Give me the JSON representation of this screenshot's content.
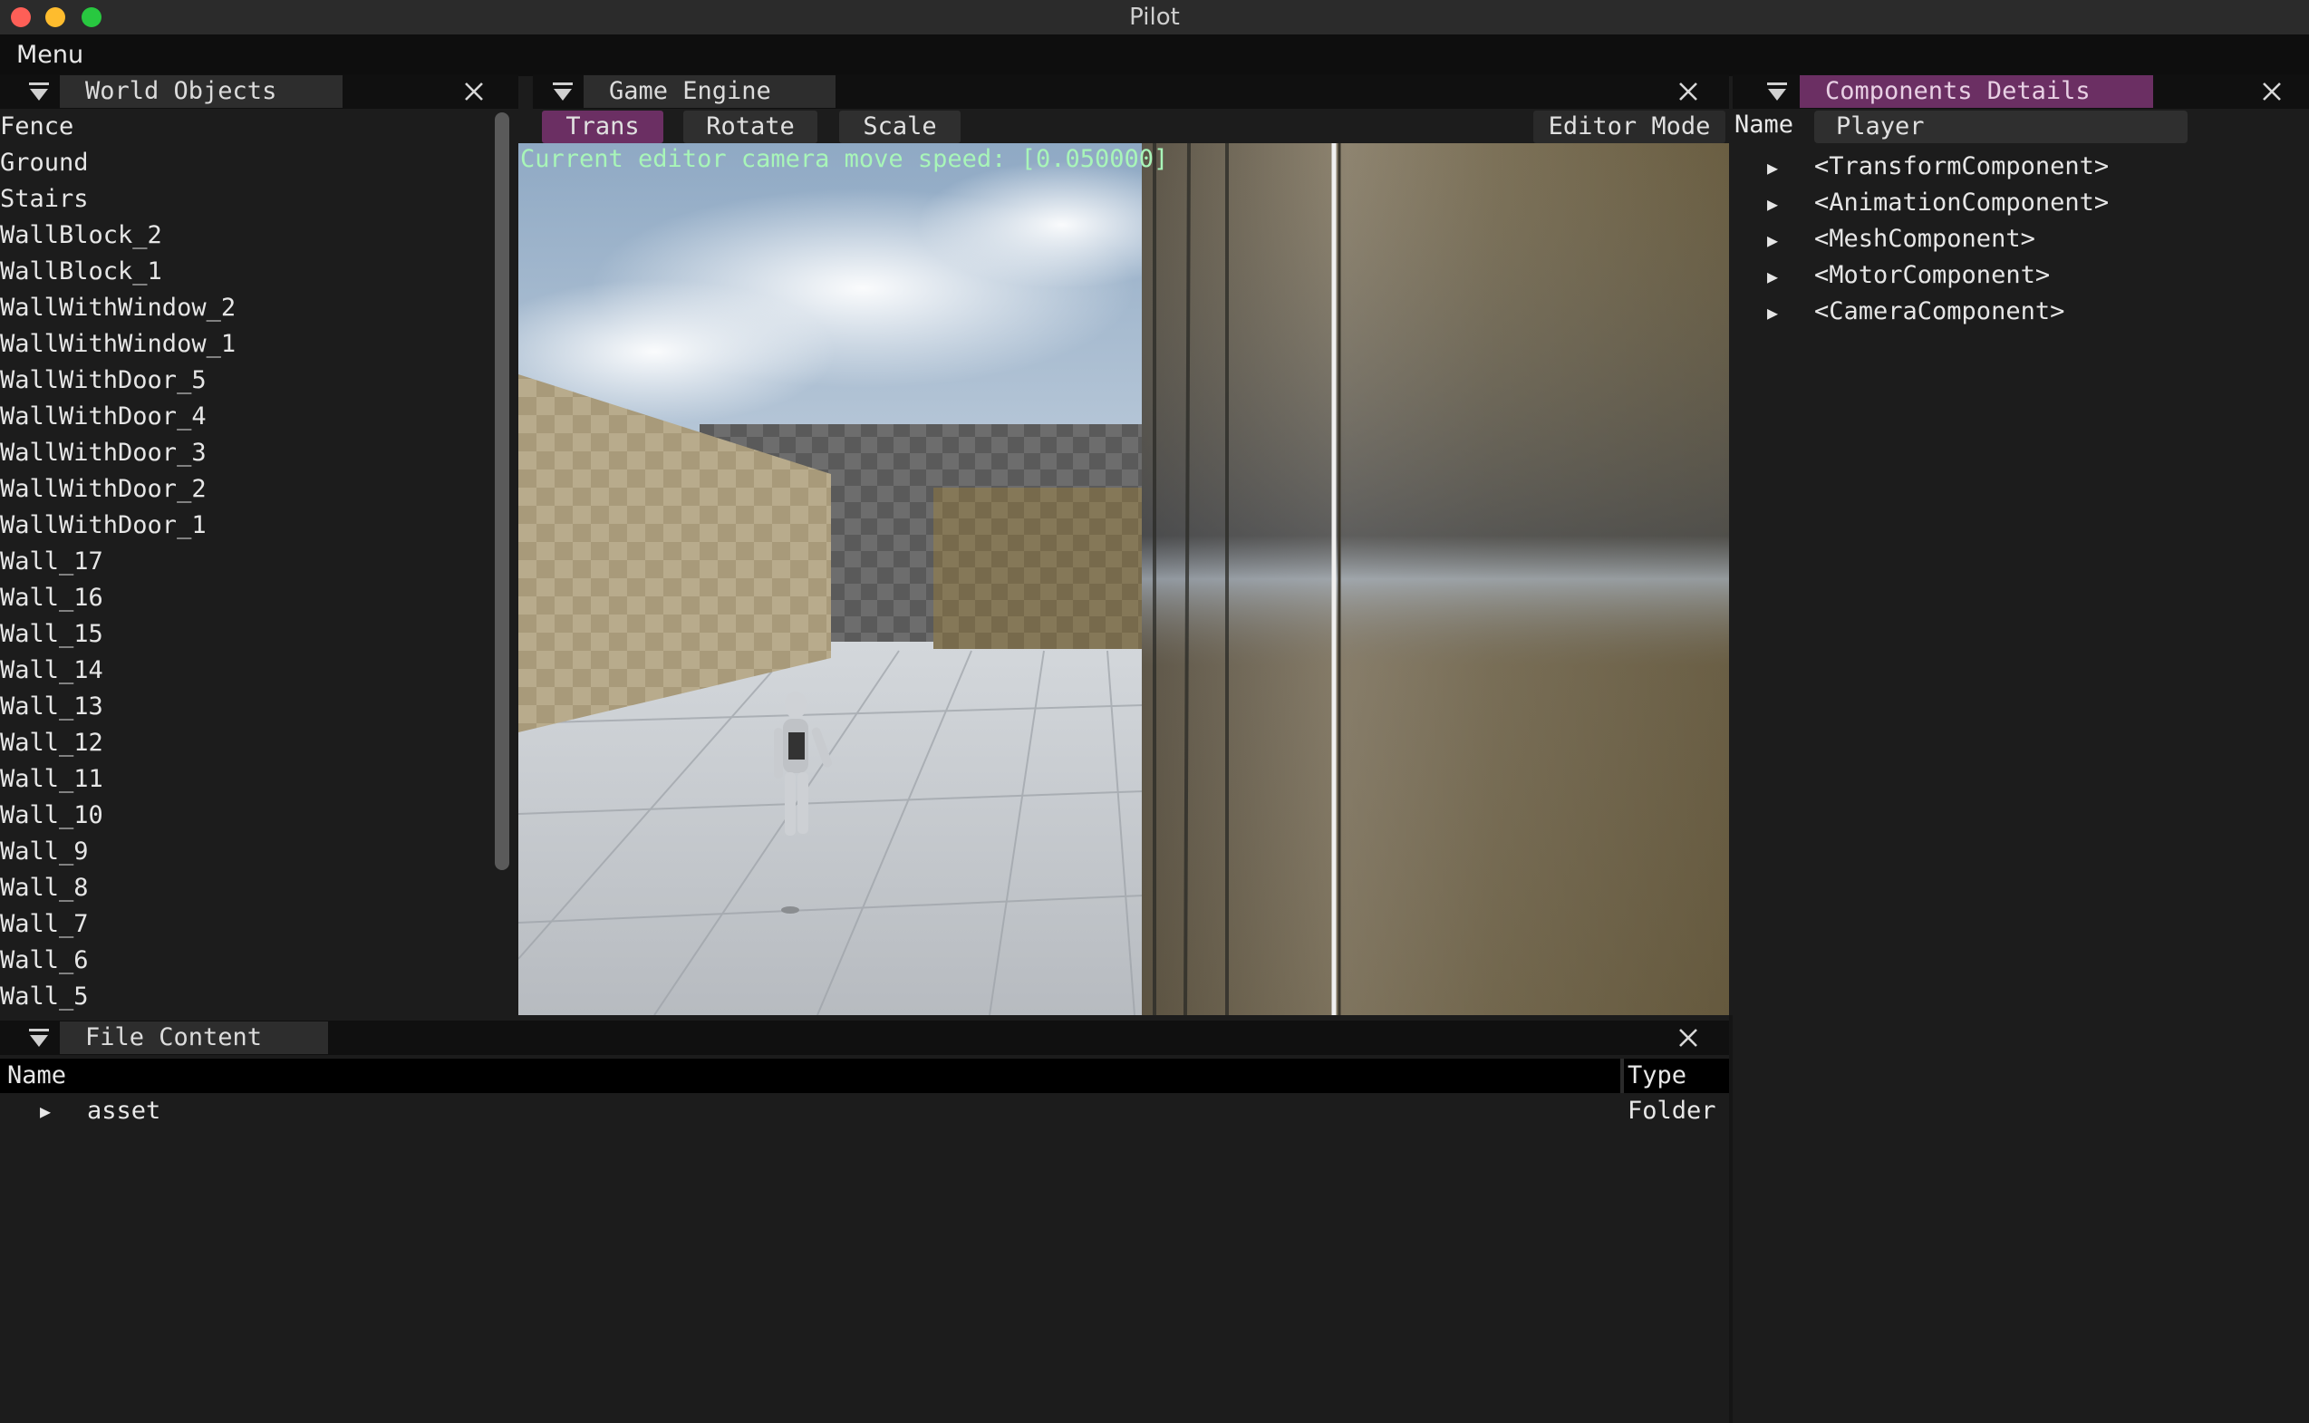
{
  "window": {
    "title": "Pilot"
  },
  "menubar": {
    "label": "Menu"
  },
  "world_objects": {
    "tab": "World Objects",
    "items": [
      "Fence",
      "Ground",
      "Stairs",
      "WallBlock_2",
      "WallBlock_1",
      "WallWithWindow_2",
      "WallWithWindow_1",
      "WallWithDoor_5",
      "WallWithDoor_4",
      "WallWithDoor_3",
      "WallWithDoor_2",
      "WallWithDoor_1",
      "Wall_17",
      "Wall_16",
      "Wall_15",
      "Wall_14",
      "Wall_13",
      "Wall_12",
      "Wall_11",
      "Wall_10",
      "Wall_9",
      "Wall_8",
      "Wall_7",
      "Wall_6",
      "Wall_5"
    ]
  },
  "game_engine": {
    "tab": "Game Engine",
    "buttons": {
      "trans": "Trans",
      "rotate": "Rotate",
      "scale": "Scale",
      "editor_mode": "Editor Mode"
    },
    "speed_text": "Current editor camera move speed: [0.050000]"
  },
  "components": {
    "tab": "Components Details",
    "name_label": "Name",
    "name_value": "Player",
    "items": [
      "<TransformComponent>",
      "<AnimationComponent>",
      "<MeshComponent>",
      "<MotorComponent>",
      "<CameraComponent>"
    ]
  },
  "file_content": {
    "tab": "File Content",
    "columns": {
      "name": "Name",
      "type": "Type"
    },
    "rows": [
      {
        "name": "asset",
        "type": "Folder"
      }
    ]
  },
  "colors": {
    "active_tab": "#6b2f63",
    "speed_text": "#a8f5b8",
    "background": "#1c1c1c"
  },
  "icons": [
    "collapse-triangle-icon",
    "close-icon",
    "tree-expand-arrow-icon"
  ]
}
